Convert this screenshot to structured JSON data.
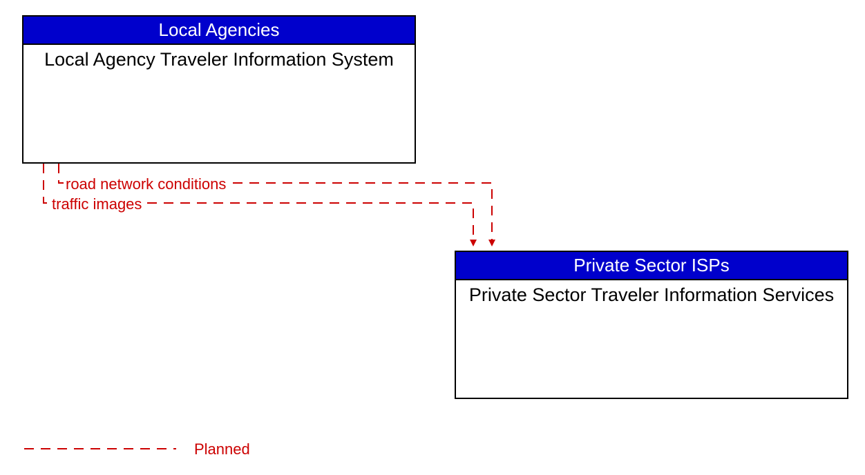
{
  "boxes": {
    "local": {
      "header": "Local Agencies",
      "body": "Local Agency Traveler Information System"
    },
    "private": {
      "header": "Private Sector ISPs",
      "body": "Private Sector Traveler Information Services"
    }
  },
  "flows": {
    "f1": "road network conditions",
    "f2": "traffic images"
  },
  "legend": {
    "planned": "Planned"
  },
  "colors": {
    "header_bg": "#0000cc",
    "planned": "#cc0000"
  }
}
